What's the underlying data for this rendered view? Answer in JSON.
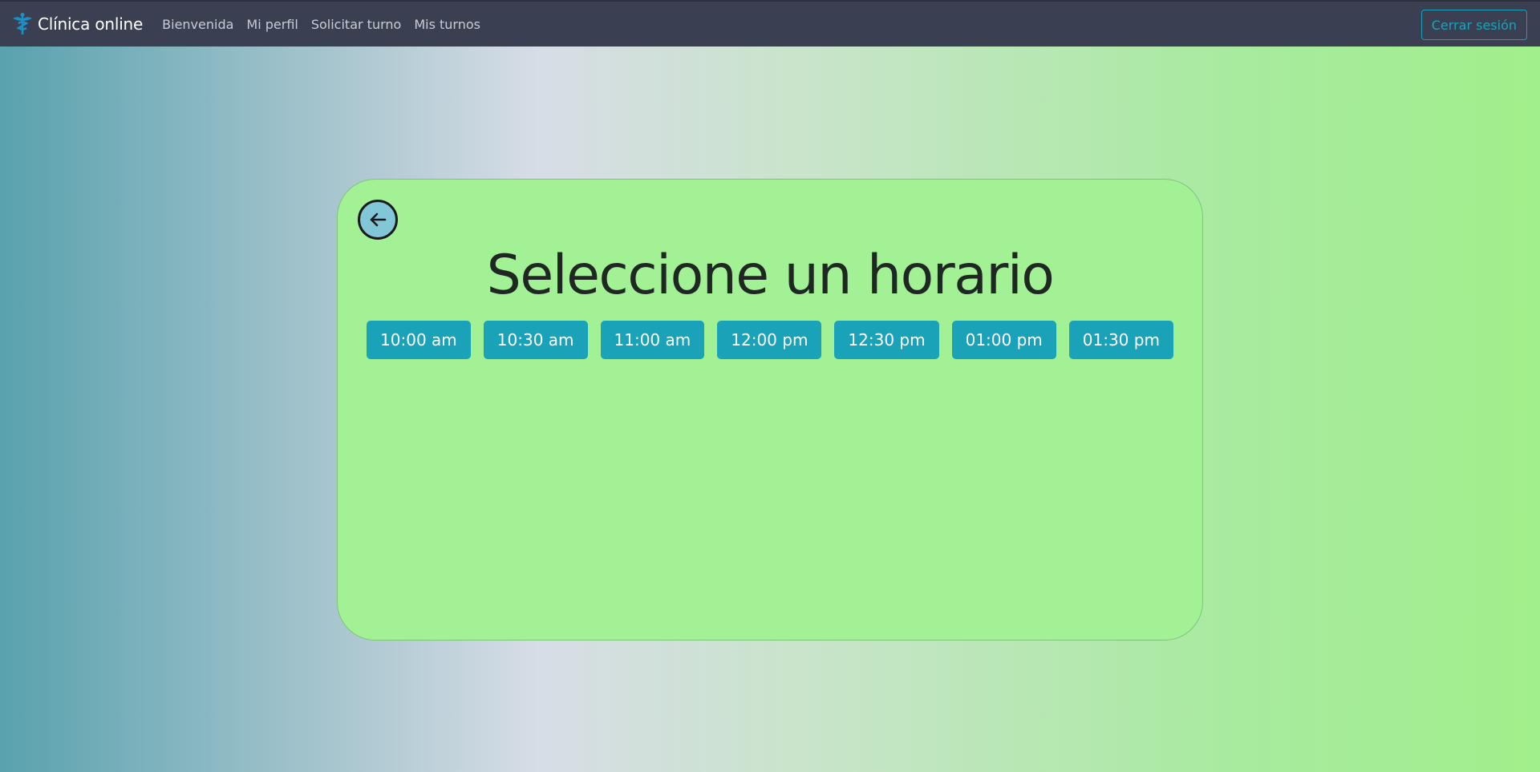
{
  "navbar": {
    "brand_name": "Clínica online",
    "brand_icon": "caduceus-icon",
    "links": [
      {
        "label": "Bienvenida"
      },
      {
        "label": "Mi perfil"
      },
      {
        "label": "Solicitar turno"
      },
      {
        "label": "Mis turnos"
      }
    ],
    "logout_label": "Cerrar sesión"
  },
  "card": {
    "back_icon": "arrow-left-icon",
    "title": "Seleccione un horario",
    "slots": [
      {
        "label": "10:00 am"
      },
      {
        "label": "10:30 am"
      },
      {
        "label": "11:00 am"
      },
      {
        "label": "12:00 pm"
      },
      {
        "label": "12:30 pm"
      },
      {
        "label": "01:00 pm"
      },
      {
        "label": "01:30 pm"
      }
    ]
  },
  "colors": {
    "navbar": "#3a4052",
    "accent": "#1aa2b8",
    "card": "#a3f195"
  }
}
